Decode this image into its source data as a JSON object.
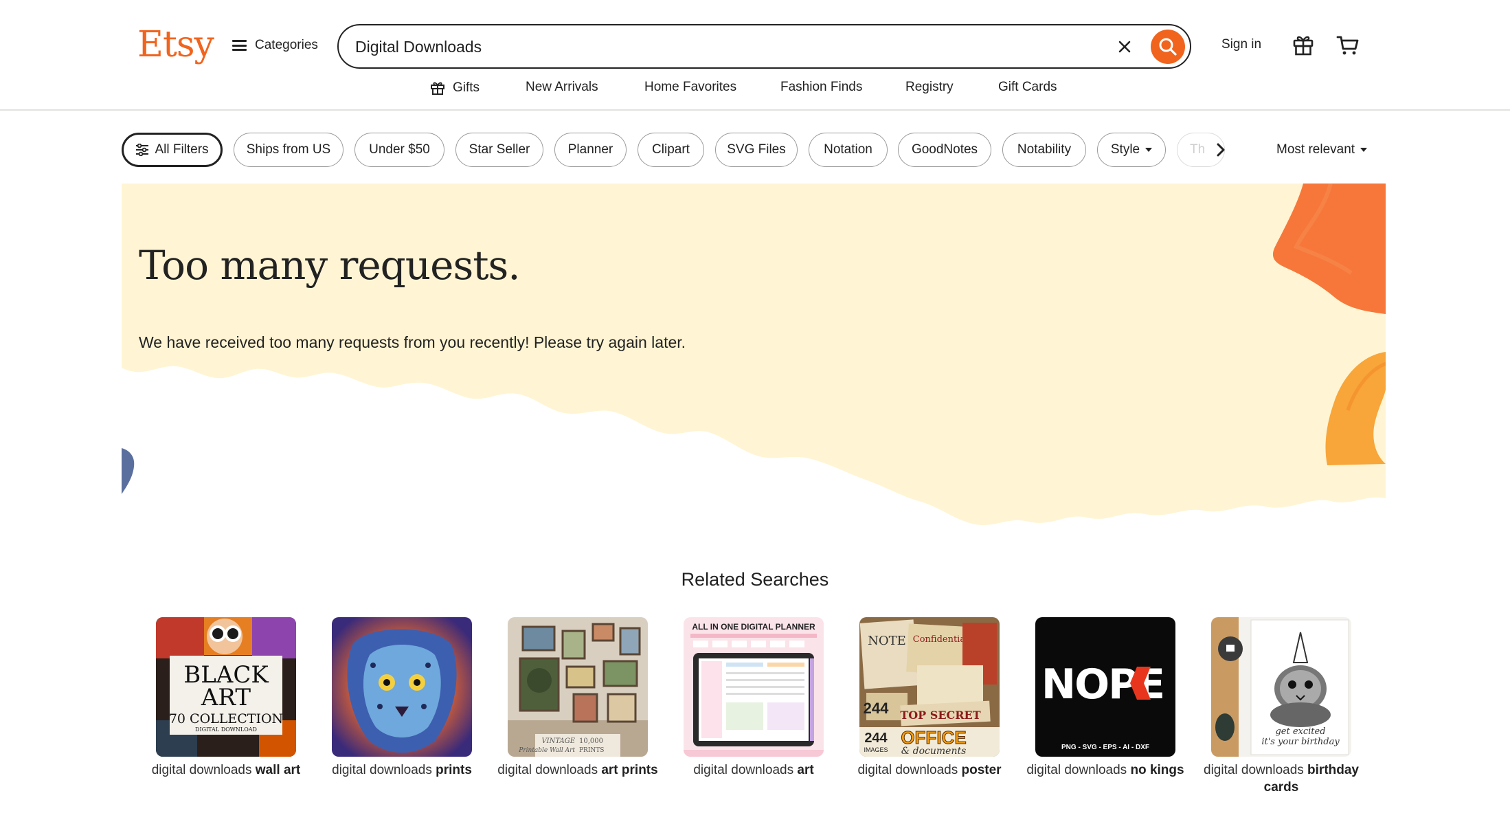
{
  "header": {
    "logo": "Etsy",
    "categories_label": "Categories",
    "search": {
      "value": "Digital Downloads"
    },
    "signin_label": "Sign in",
    "nav": [
      "Gifts",
      "New Arrivals",
      "Home Favorites",
      "Fashion Finds",
      "Registry",
      "Gift Cards"
    ]
  },
  "filters": {
    "all_filters": "All Filters",
    "chips": [
      "Ships from US",
      "Under $50",
      "Star Seller",
      "Planner",
      "Clipart",
      "SVG Files",
      "Notation",
      "GoodNotes",
      "Notability",
      "Style"
    ],
    "faded_chip": "Th",
    "sort_label": "Most relevant"
  },
  "error": {
    "title": "Too many requests.",
    "message": "We have received too many requests from you recently! Please try again later."
  },
  "related": {
    "title": "Related Searches",
    "items": [
      {
        "prefix": "digital downloads",
        "bold": "wall art",
        "thumb_text": [
          "BLACK",
          "ART",
          "70 COLLECTION",
          "DIGITAL DOWNLOAD"
        ]
      },
      {
        "prefix": "digital downloads",
        "bold": "prints"
      },
      {
        "prefix": "digital downloads",
        "bold": "art prints",
        "thumb_text": [
          "VINTAGE",
          "10,000",
          "Printable Wall Art",
          "PRINTS"
        ]
      },
      {
        "prefix": "digital downloads",
        "bold": "art",
        "thumb_text": [
          "ALL IN ONE DIGITAL PLANNER"
        ]
      },
      {
        "prefix": "digital downloads",
        "bold": "poster",
        "thumb_text": [
          "NOTE",
          "Confidential",
          "244",
          "IMAGES",
          "TOP SECRET",
          "OFFICE",
          "& documents"
        ]
      },
      {
        "prefix": "digital downloads",
        "bold": "no kings",
        "thumb_text": [
          "NOPE",
          "PNG - SVG - EPS - AI - DXF"
        ]
      },
      {
        "prefix": "digital downloads",
        "bold": "birthday cards",
        "thumb_text": [
          "get excited",
          "it's your birthday"
        ]
      }
    ]
  },
  "colors": {
    "brand": "#f1641e",
    "banner_bg": "#fff5d4",
    "text": "#222222"
  }
}
